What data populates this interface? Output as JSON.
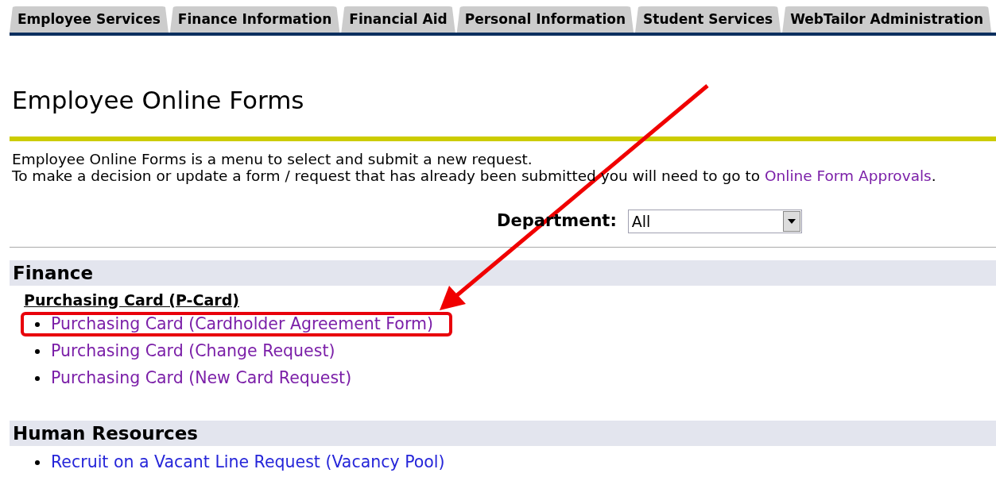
{
  "tabs": [
    {
      "label": "Employee Services",
      "selected": false
    },
    {
      "label": "Finance Information",
      "selected": false
    },
    {
      "label": "Financial Aid",
      "selected": false
    },
    {
      "label": "Personal Information",
      "selected": false
    },
    {
      "label": "Student Services",
      "selected": false
    },
    {
      "label": "WebTailor Administration",
      "selected": false
    }
  ],
  "page_title": "Employee Online Forms",
  "intro": {
    "line_1": "Employee Online Forms is a menu to select and submit a new request.",
    "line_2": "To make a decision or update a form / request that has already been submitted you will need to go to",
    "link": "Online Form Approvals",
    "end": "."
  },
  "department": {
    "label": "Department:",
    "value": "All"
  },
  "sections": [
    {
      "title": "Finance",
      "groups": [
        {
          "title": "Purchasing Card (P-Card)",
          "links": [
            {
              "label": "Purchasing Card (Cardholder Agreement Form)",
              "visited": true,
              "highlighted": true
            },
            {
              "label": "Purchasing Card (Change Request)",
              "visited": true,
              "highlighted": false
            },
            {
              "label": "Purchasing Card (New Card Request)",
              "visited": true,
              "highlighted": false
            }
          ]
        }
      ]
    },
    {
      "title": "Human Resources",
      "groups": [
        {
          "links": [
            {
              "label": "Recruit on a Vacant Line Request (Vacancy Pool)",
              "visited": false,
              "highlighted": false
            }
          ]
        }
      ]
    }
  ]
}
